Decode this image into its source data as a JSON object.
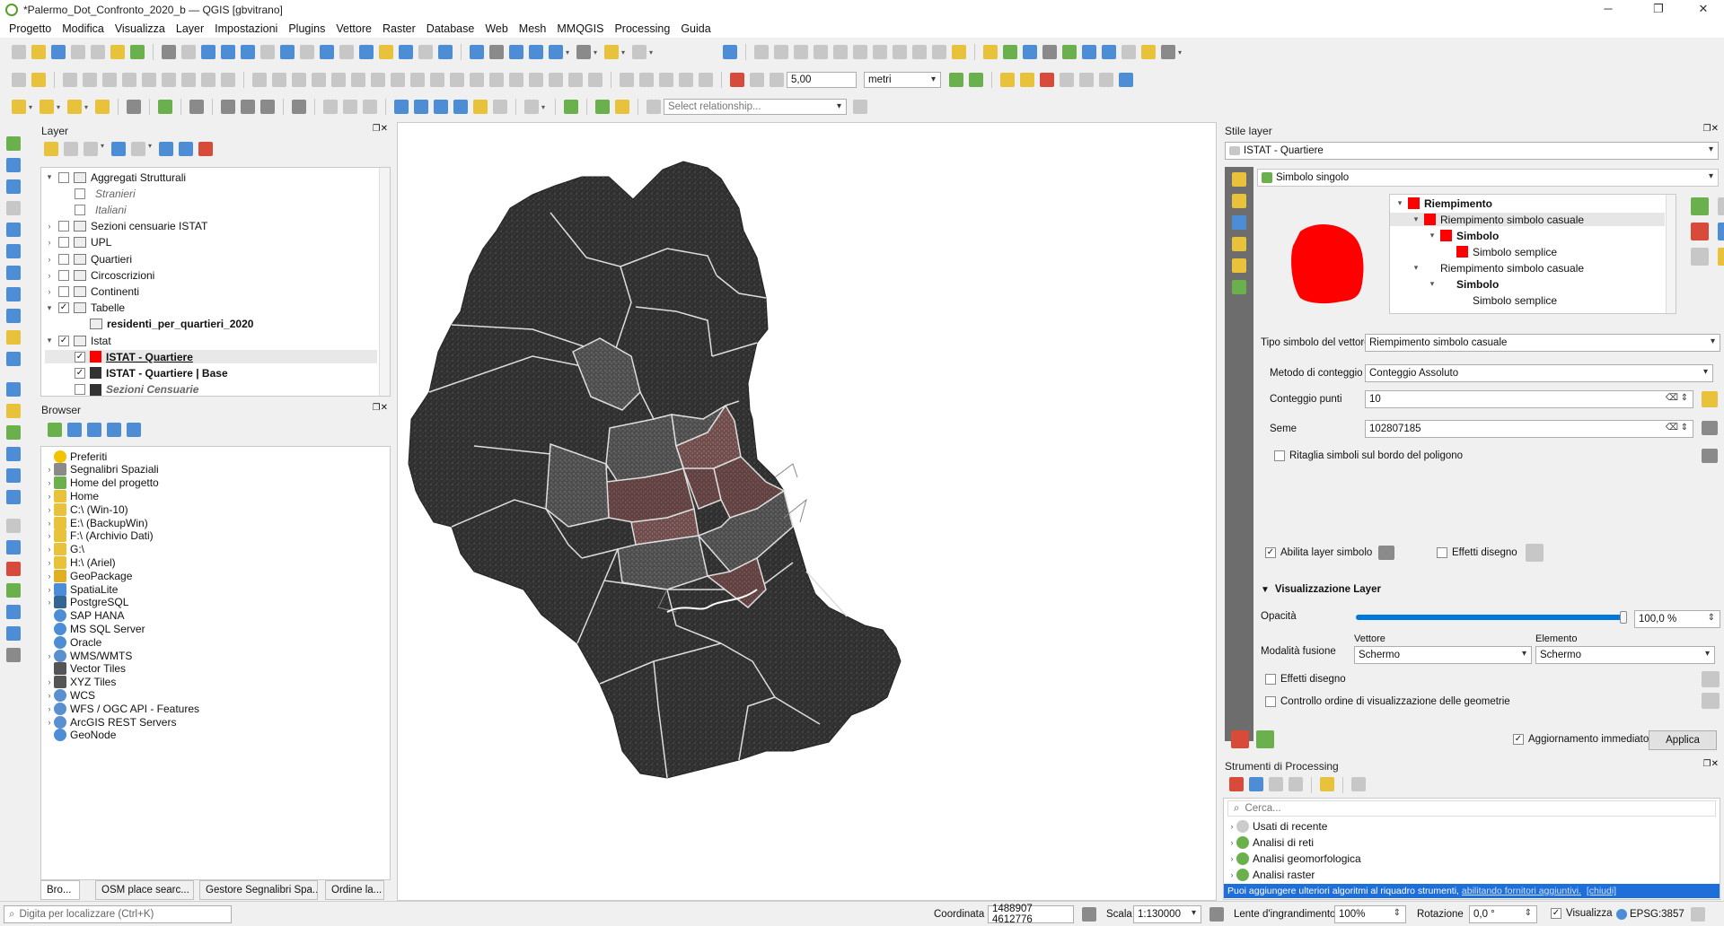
{
  "window": {
    "title": "*Palermo_Dot_Confronto_2020_b — QGIS [gbvitrano]",
    "minimize": "─",
    "maximize": "❐",
    "close": "✕"
  },
  "menu": [
    "Progetto",
    "Modifica",
    "Visualizza",
    "Layer",
    "Impostazioni",
    "Plugins",
    "Vettore",
    "Raster",
    "Database",
    "Web",
    "Mesh",
    "MMQGIS",
    "Processing",
    "Guida"
  ],
  "toolbar": {
    "snap_tolerance": "5,00",
    "snap_units": "metri",
    "relationship_placeholder": "Select relationship..."
  },
  "layers_panel": {
    "title": "Layer",
    "items": [
      {
        "label": "Aggregati Strutturali",
        "checked": false,
        "bold": false,
        "italic": false,
        "indent": 0,
        "expand": "down",
        "icon": "group"
      },
      {
        "label": "Stranieri",
        "checked": false,
        "italic": true,
        "bold": false,
        "indent": 1,
        "expand": "",
        "icon": "none"
      },
      {
        "label": "Italiani",
        "checked": false,
        "italic": true,
        "bold": false,
        "indent": 1,
        "expand": "",
        "icon": "none"
      },
      {
        "label": "Sezioni censuarie ISTAT",
        "checked": false,
        "bold": false,
        "italic": false,
        "indent": 0,
        "expand": "right",
        "icon": "group"
      },
      {
        "label": "UPL",
        "checked": false,
        "bold": false,
        "italic": false,
        "indent": 0,
        "expand": "right",
        "icon": "group"
      },
      {
        "label": "Quartieri",
        "checked": false,
        "bold": false,
        "italic": false,
        "indent": 0,
        "expand": "right",
        "icon": "group"
      },
      {
        "label": "Circoscrizioni",
        "checked": false,
        "bold": false,
        "italic": false,
        "indent": 0,
        "expand": "right",
        "icon": "group"
      },
      {
        "label": "Continenti",
        "checked": false,
        "bold": false,
        "italic": false,
        "indent": 0,
        "expand": "right",
        "icon": "group"
      },
      {
        "label": "Tabelle",
        "checked": true,
        "bold": false,
        "italic": false,
        "indent": 0,
        "expand": "down",
        "icon": "group"
      },
      {
        "label": "residenti_per_quartieri_2020",
        "checked": null,
        "bold": true,
        "italic": false,
        "indent": 1,
        "expand": "",
        "icon": "table"
      },
      {
        "label": "Istat",
        "checked": true,
        "bold": false,
        "italic": false,
        "indent": 0,
        "expand": "down",
        "icon": "group"
      },
      {
        "label": "ISTAT - Quartiere",
        "checked": true,
        "bold": true,
        "italic": false,
        "underline": true,
        "indent": 1,
        "expand": "",
        "icon": "red",
        "selected": true
      },
      {
        "label": "ISTAT - Quartiere | Base",
        "checked": true,
        "bold": true,
        "italic": false,
        "indent": 1,
        "expand": "",
        "icon": "dark"
      },
      {
        "label": "Sezioni Censuarie",
        "checked": false,
        "bold": true,
        "italic": true,
        "indent": 1,
        "expand": "",
        "icon": "dark"
      }
    ]
  },
  "browser_panel": {
    "title": "Browser",
    "items": [
      {
        "label": "Preferiti",
        "icon": "star",
        "expand": ""
      },
      {
        "label": "Segnalibri Spaziali",
        "icon": "bookmark",
        "expand": "right"
      },
      {
        "label": "Home del progetto",
        "icon": "green",
        "expand": "right"
      },
      {
        "label": "Home",
        "icon": "folder",
        "expand": "right"
      },
      {
        "label": "C:\\ (Win-10)",
        "icon": "folder",
        "expand": "right"
      },
      {
        "label": "E:\\ (BackupWin)",
        "icon": "folder",
        "expand": "right"
      },
      {
        "label": "F:\\ (Archivio Dati)",
        "icon": "folder",
        "expand": "right"
      },
      {
        "label": "G:\\",
        "icon": "folder",
        "expand": "right"
      },
      {
        "label": "H:\\ (Ariel)",
        "icon": "folder",
        "expand": "right"
      },
      {
        "label": "GeoPackage",
        "icon": "gpkg",
        "expand": "right"
      },
      {
        "label": "SpatiaLite",
        "icon": "feather",
        "expand": "right"
      },
      {
        "label": "PostgreSQL",
        "icon": "pg",
        "expand": "right"
      },
      {
        "label": "SAP HANA",
        "icon": "db",
        "expand": ""
      },
      {
        "label": "MS SQL Server",
        "icon": "db",
        "expand": ""
      },
      {
        "label": "Oracle",
        "icon": "db",
        "expand": ""
      },
      {
        "label": "WMS/WMTS",
        "icon": "globe",
        "expand": "right"
      },
      {
        "label": "Vector Tiles",
        "icon": "grid",
        "expand": ""
      },
      {
        "label": "XYZ Tiles",
        "icon": "grid",
        "expand": "right"
      },
      {
        "label": "WCS",
        "icon": "globe",
        "expand": "right"
      },
      {
        "label": "WFS / OGC API - Features",
        "icon": "globe",
        "expand": "right"
      },
      {
        "label": "ArcGIS REST Servers",
        "icon": "globe",
        "expand": "right"
      },
      {
        "label": "GeoNode",
        "icon": "geonode",
        "expand": ""
      }
    ],
    "tabs": [
      "Bro...",
      "OSM place searc...",
      "Gestore Segnalibri Spa...",
      "Ordine la..."
    ]
  },
  "style_panel": {
    "title": "Stile layer",
    "layer": "ISTAT - Quartiere",
    "renderer": "Simbolo singolo",
    "tree": [
      {
        "label": "Riempimento",
        "bold": true,
        "level": 0,
        "swatch": true
      },
      {
        "label": "Riempimento simbolo casuale",
        "bold": false,
        "level": 1,
        "swatch": true,
        "selected": true
      },
      {
        "label": "Simbolo",
        "bold": true,
        "level": 2,
        "swatch": true
      },
      {
        "label": "Simbolo semplice",
        "bold": false,
        "level": 3,
        "swatch": true
      },
      {
        "label": "Riempimento simbolo casuale",
        "bold": false,
        "level": 1,
        "swatch": false
      },
      {
        "label": "Simbolo",
        "bold": true,
        "level": 2,
        "swatch": false
      },
      {
        "label": "Simbolo semplice",
        "bold": false,
        "level": 3,
        "swatch": false
      }
    ],
    "symbol_type_label": "Tipo simbolo del vettore",
    "symbol_type": "Riempimento simbolo casuale",
    "count_method_label": "Metodo di conteggio",
    "count_method": "Conteggio Assoluto",
    "point_count_label": "Conteggio punti",
    "point_count": "10",
    "seed_label": "Seme",
    "seed": "102807185",
    "clip_label": "Ritaglia simboli sul bordo del poligono",
    "enable_layer_label": "Abilita layer simbolo",
    "effects_label": "Effetti disegno",
    "render_section": "Visualizzazione Layer",
    "opacity_label": "Opacità",
    "opacity": "100,0 %",
    "opacity_fraction": 1.0,
    "blend_label": "Modalità fusione",
    "blend_vector_label": "Vettore",
    "blend_feature_label": "Elemento",
    "blend_vector": "Schermo",
    "blend_feature": "Schermo",
    "effects2_label": "Effetti disegno",
    "order_label": "Controllo ordine di visualizzazione delle geometrie",
    "live_update_label": "Aggiornamento immediato",
    "apply_label": "Applica"
  },
  "processing_panel": {
    "title": "Strumenti di Processing",
    "search_placeholder": "Cerca...",
    "items": [
      "Usati di recente",
      "Analisi di reti",
      "Analisi geomorfologica",
      "Analisi raster"
    ],
    "banner": "Puoi aggiungere ulteriori algoritmi al riquadro strumenti,",
    "banner_link": "abilitando fornitori aggiuntivi.",
    "banner_close": "[chiudi]"
  },
  "statusbar": {
    "locate_placeholder": "Digita per localizzare (Ctrl+K)",
    "coord_label": "Coordinata",
    "coord": "1488907 4612776",
    "scale_label": "Scala",
    "scale": "1:130000",
    "magnifier_label": "Lente d'ingrandimento",
    "magnifier": "100%",
    "rotation_label": "Rotazione",
    "rotation": "0,0 °",
    "render_label": "Visualizza",
    "crs": "EPSG:3857"
  },
  "colors": {
    "accent": "#0078d7",
    "symbol_red": "#ff0000",
    "map_dark": "#333333",
    "map_red": "#6a3535",
    "map_mid": "#555555",
    "link": "#0000ee"
  }
}
